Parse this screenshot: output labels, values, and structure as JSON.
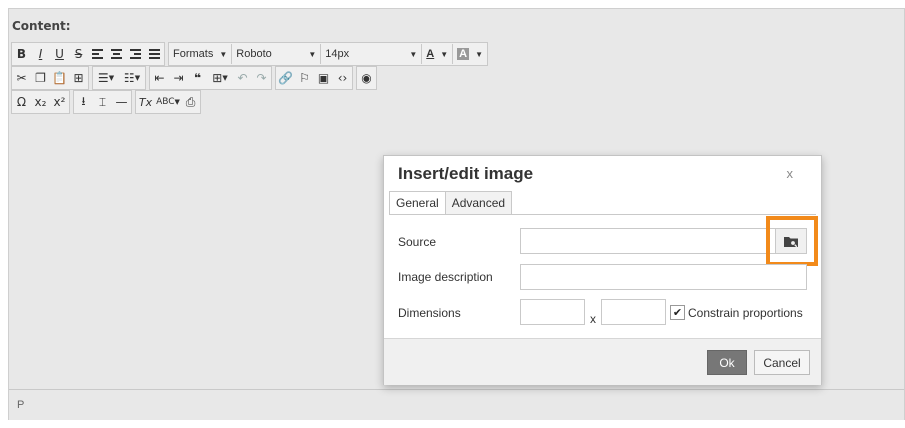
{
  "editor": {
    "label": "Content:",
    "status_path": "P"
  },
  "toolbar": {
    "row1": {
      "bold": "B",
      "italic": "I",
      "underline": "U",
      "strikethrough": "S",
      "formats": "Formats",
      "font_family": "Roboto",
      "font_size": "14px",
      "text_color": "A",
      "background_color": "A"
    },
    "row3": {
      "omega": "Ω",
      "subscript": "x₂",
      "superscript": "x²",
      "remove_format": "Tx"
    }
  },
  "icons": {
    "align": [
      "align-left-icon",
      "align-center-icon",
      "align-right-icon",
      "align-justify-icon"
    ],
    "row2": [
      "cut-icon",
      "copy-icon",
      "paste-icon",
      "find-replace-icon",
      "bullet-list-icon",
      "numbered-list-icon",
      "outdent-icon",
      "indent-icon",
      "blockquote-icon",
      "table-icon",
      "undo-icon",
      "redo-icon",
      "link-icon",
      "anchor-icon",
      "image-icon",
      "code-icon",
      "preview-icon"
    ],
    "row3": [
      "upload-icon",
      "page-break-icon",
      "horizontal-rule-icon",
      "spellcheck-icon",
      "print-icon"
    ],
    "browse": "folder-search-icon"
  },
  "dialog": {
    "title": "Insert/edit image",
    "close": "x",
    "tabs": [
      "General",
      "Advanced"
    ],
    "fields": {
      "source_label": "Source",
      "source_value": "",
      "description_label": "Image description",
      "description_value": "",
      "dimensions_label": "Dimensions",
      "width_value": "",
      "height_value": "",
      "separator": "x",
      "constrain_label": "Constrain proportions",
      "constrain_checked": true
    },
    "buttons": {
      "ok": "Ok",
      "cancel": "Cancel"
    }
  },
  "colors": {
    "highlight": "#f28a1a",
    "editor_bg": "#e8e8e8",
    "ok_button": "#777777"
  }
}
